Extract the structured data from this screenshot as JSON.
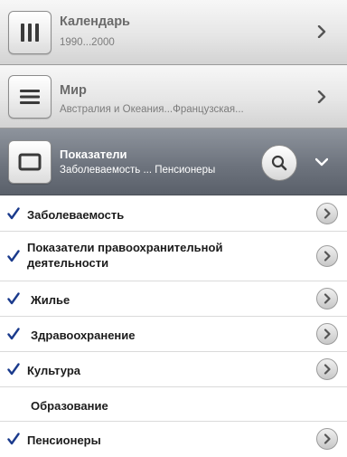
{
  "sections": {
    "calendar": {
      "title": "Календарь",
      "subtitle": "1990...2000",
      "icon": "columns-icon"
    },
    "world": {
      "title": "Мир",
      "subtitle": "Австралия и Океания...Французская...",
      "icon": "list-icon"
    },
    "indicators": {
      "title": "Показатели",
      "subtitle": "Заболеваемость ... Пенсионеры",
      "icon": "square-icon"
    }
  },
  "list": {
    "items": [
      {
        "label": "Заболеваемость",
        "checked": true
      },
      {
        "label": "Показатели правоохранительной деятельности",
        "checked": true
      },
      {
        "label": "Жилье",
        "checked": true
      },
      {
        "label": "Здравоохранение",
        "checked": true
      },
      {
        "label": "Культура",
        "checked": true
      },
      {
        "label": "Образование",
        "checked": false
      },
      {
        "label": "Пенсионеры",
        "checked": true
      }
    ]
  },
  "colors": {
    "check": "#1a3a8c",
    "header_dark": "#6e747e",
    "header_light": "#e6e6e6"
  }
}
